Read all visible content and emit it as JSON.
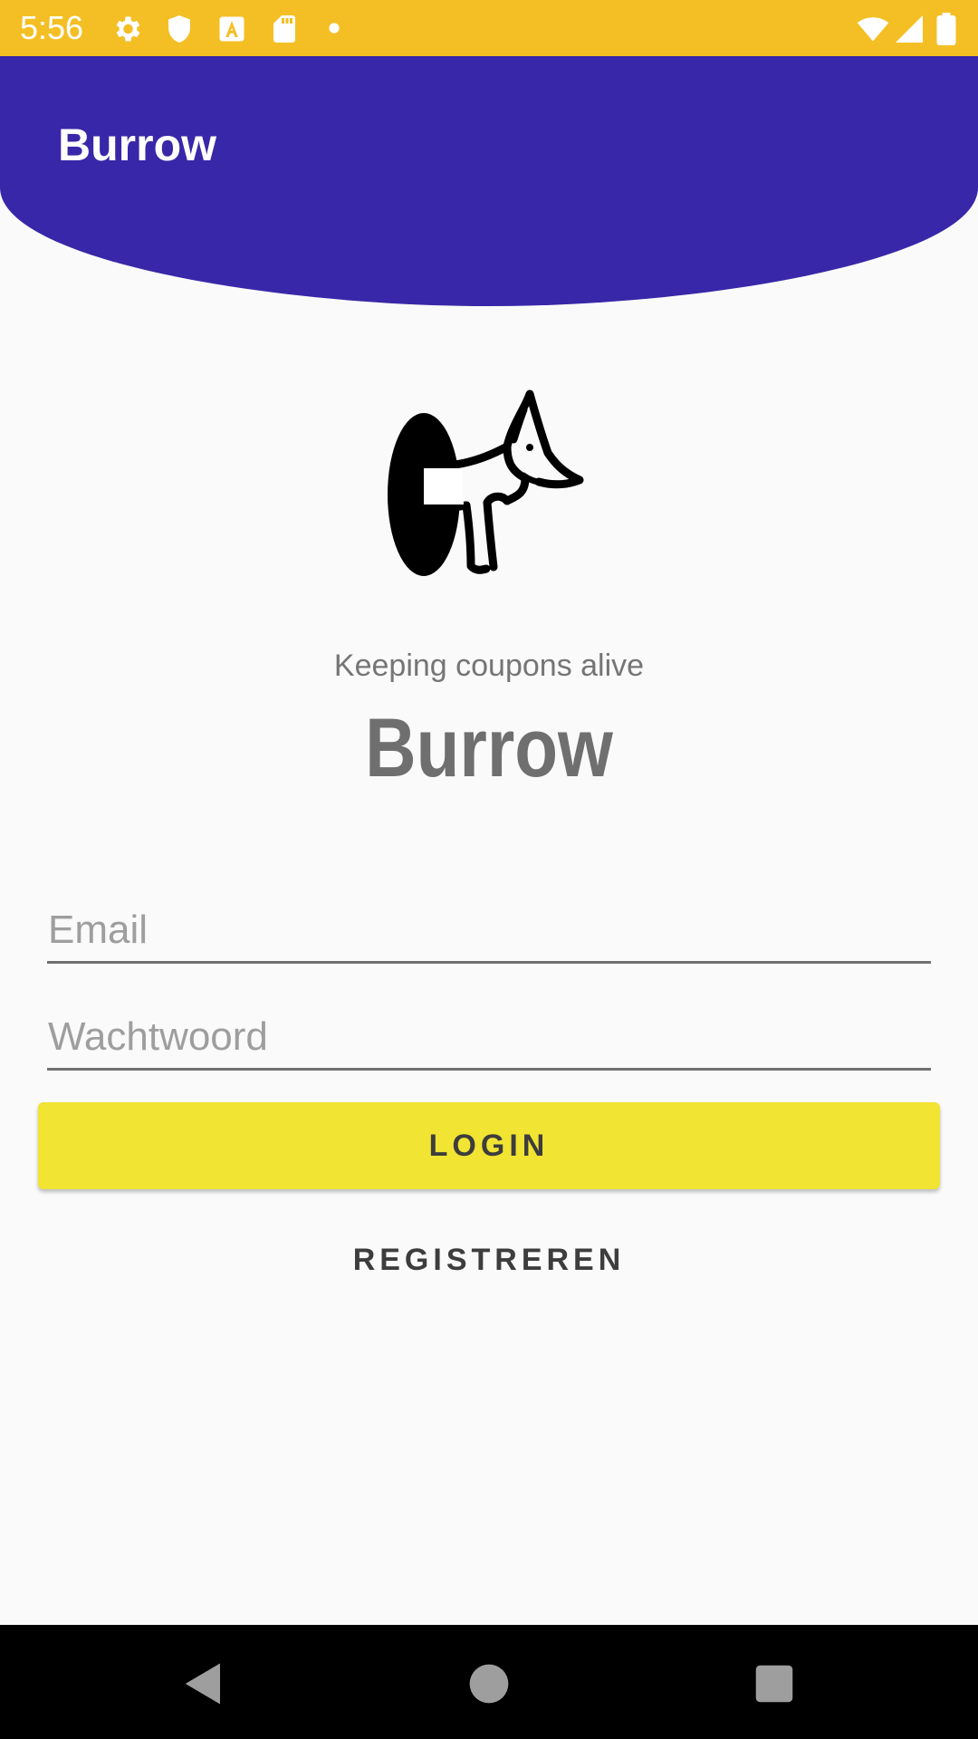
{
  "status_bar": {
    "time": "5:56",
    "left_icons": [
      "gear-icon",
      "shield-icon",
      "font-a-icon",
      "sd-card-icon",
      "dot-icon"
    ],
    "right_icons": [
      "wifi-icon",
      "signal-icon",
      "battery-icon"
    ]
  },
  "header": {
    "title": "Burrow",
    "color": "#3827a8"
  },
  "logo": {
    "icon": "dog-burrow-logo"
  },
  "main": {
    "tagline": "Keeping coupons alive",
    "brand_name": "Burrow"
  },
  "form": {
    "email_placeholder": "Email",
    "password_placeholder": "Wachtwoord",
    "login_label": "LOGIN",
    "register_label": "REGISTREREN",
    "login_color": "#f1e432"
  },
  "nav_bar": {
    "buttons": [
      "back-icon",
      "home-icon",
      "recents-icon"
    ]
  }
}
